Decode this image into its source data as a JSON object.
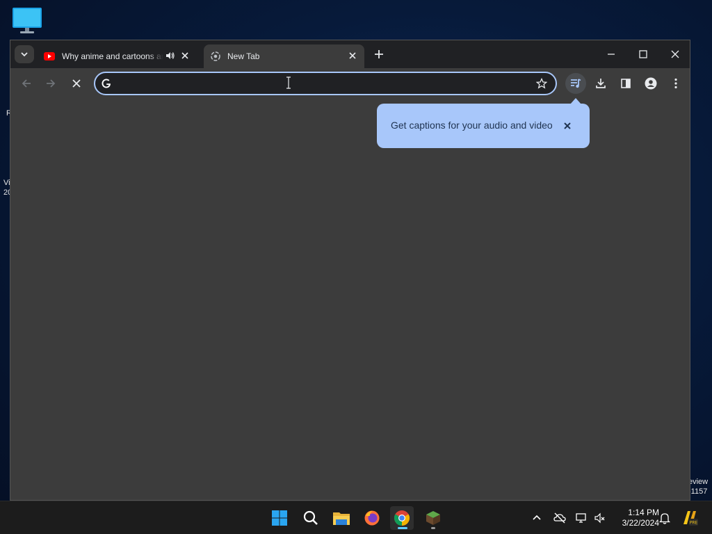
{
  "desktop": {
    "fragments": [
      "R",
      "Vi\n20",
      "eview\n-1157"
    ]
  },
  "browser": {
    "tabs": [
      {
        "title": "Why anime and cartoons are",
        "favicon": "youtube-icon",
        "audio": true,
        "active": false
      },
      {
        "title": "New Tab",
        "favicon": "chrome-icon",
        "active": true
      }
    ],
    "omnibox": {
      "value": "",
      "placeholder": ""
    },
    "caption_bubble": {
      "text": "Get captions for your audio and video"
    }
  },
  "taskbar": {
    "apps": [
      "windows-start-icon",
      "search-icon",
      "file-explorer-icon",
      "firefox-icon",
      "chrome-icon",
      "minecraft-icon"
    ],
    "clock": {
      "time": "1:14 PM",
      "date": "3/22/2024"
    }
  },
  "colors": {
    "accent": "#a8c7fa",
    "tabstrip": "#202124",
    "window": "#3c3c3c",
    "taskbar": "#1c1c1c"
  }
}
